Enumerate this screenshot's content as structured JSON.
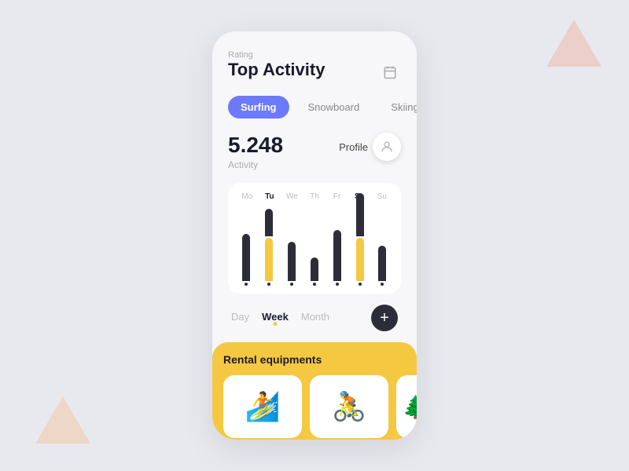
{
  "background": {
    "color": "#e8e8ef"
  },
  "header": {
    "rating_label": "Rating",
    "title": "Top Activity",
    "calendar_icon": "📅"
  },
  "tabs": [
    {
      "id": "surfing",
      "label": "Surfing",
      "active": true
    },
    {
      "id": "snowboard",
      "label": "Snowboard",
      "active": false
    },
    {
      "id": "skiing",
      "label": "Skiing",
      "active": false
    }
  ],
  "stats": {
    "value": "5.248",
    "label": "Activity"
  },
  "profile": {
    "label": "Profile"
  },
  "chart": {
    "days": [
      {
        "label": "Mo",
        "active": false
      },
      {
        "label": "Tu",
        "active": true
      },
      {
        "label": "We",
        "active": false
      },
      {
        "label": "Th",
        "active": false
      },
      {
        "label": "Fr",
        "active": false
      },
      {
        "label": "Sa",
        "active": true
      },
      {
        "label": "Su",
        "active": false
      }
    ],
    "bars": [
      {
        "dark_height": 60,
        "yellow_height": 0,
        "has_dot": true
      },
      {
        "dark_height": 40,
        "yellow_height": 55,
        "has_dot": true
      },
      {
        "dark_height": 50,
        "yellow_height": 0,
        "has_dot": true
      },
      {
        "dark_height": 30,
        "yellow_height": 0,
        "has_dot": true
      },
      {
        "dark_height": 65,
        "yellow_height": 0,
        "has_dot": true
      },
      {
        "dark_height": 75,
        "yellow_height": 55,
        "has_dot": true
      },
      {
        "dark_height": 55,
        "yellow_height": 0,
        "has_dot": true
      }
    ]
  },
  "period": {
    "tabs": [
      {
        "label": "Day",
        "active": false
      },
      {
        "label": "Week",
        "active": true
      },
      {
        "label": "Month",
        "active": false
      }
    ],
    "add_btn_label": "+"
  },
  "rental": {
    "title": "Rental equipments",
    "cards": [
      {
        "emoji": "🏄"
      },
      {
        "emoji": "🚴"
      },
      {
        "emoji": "🌲"
      }
    ]
  }
}
